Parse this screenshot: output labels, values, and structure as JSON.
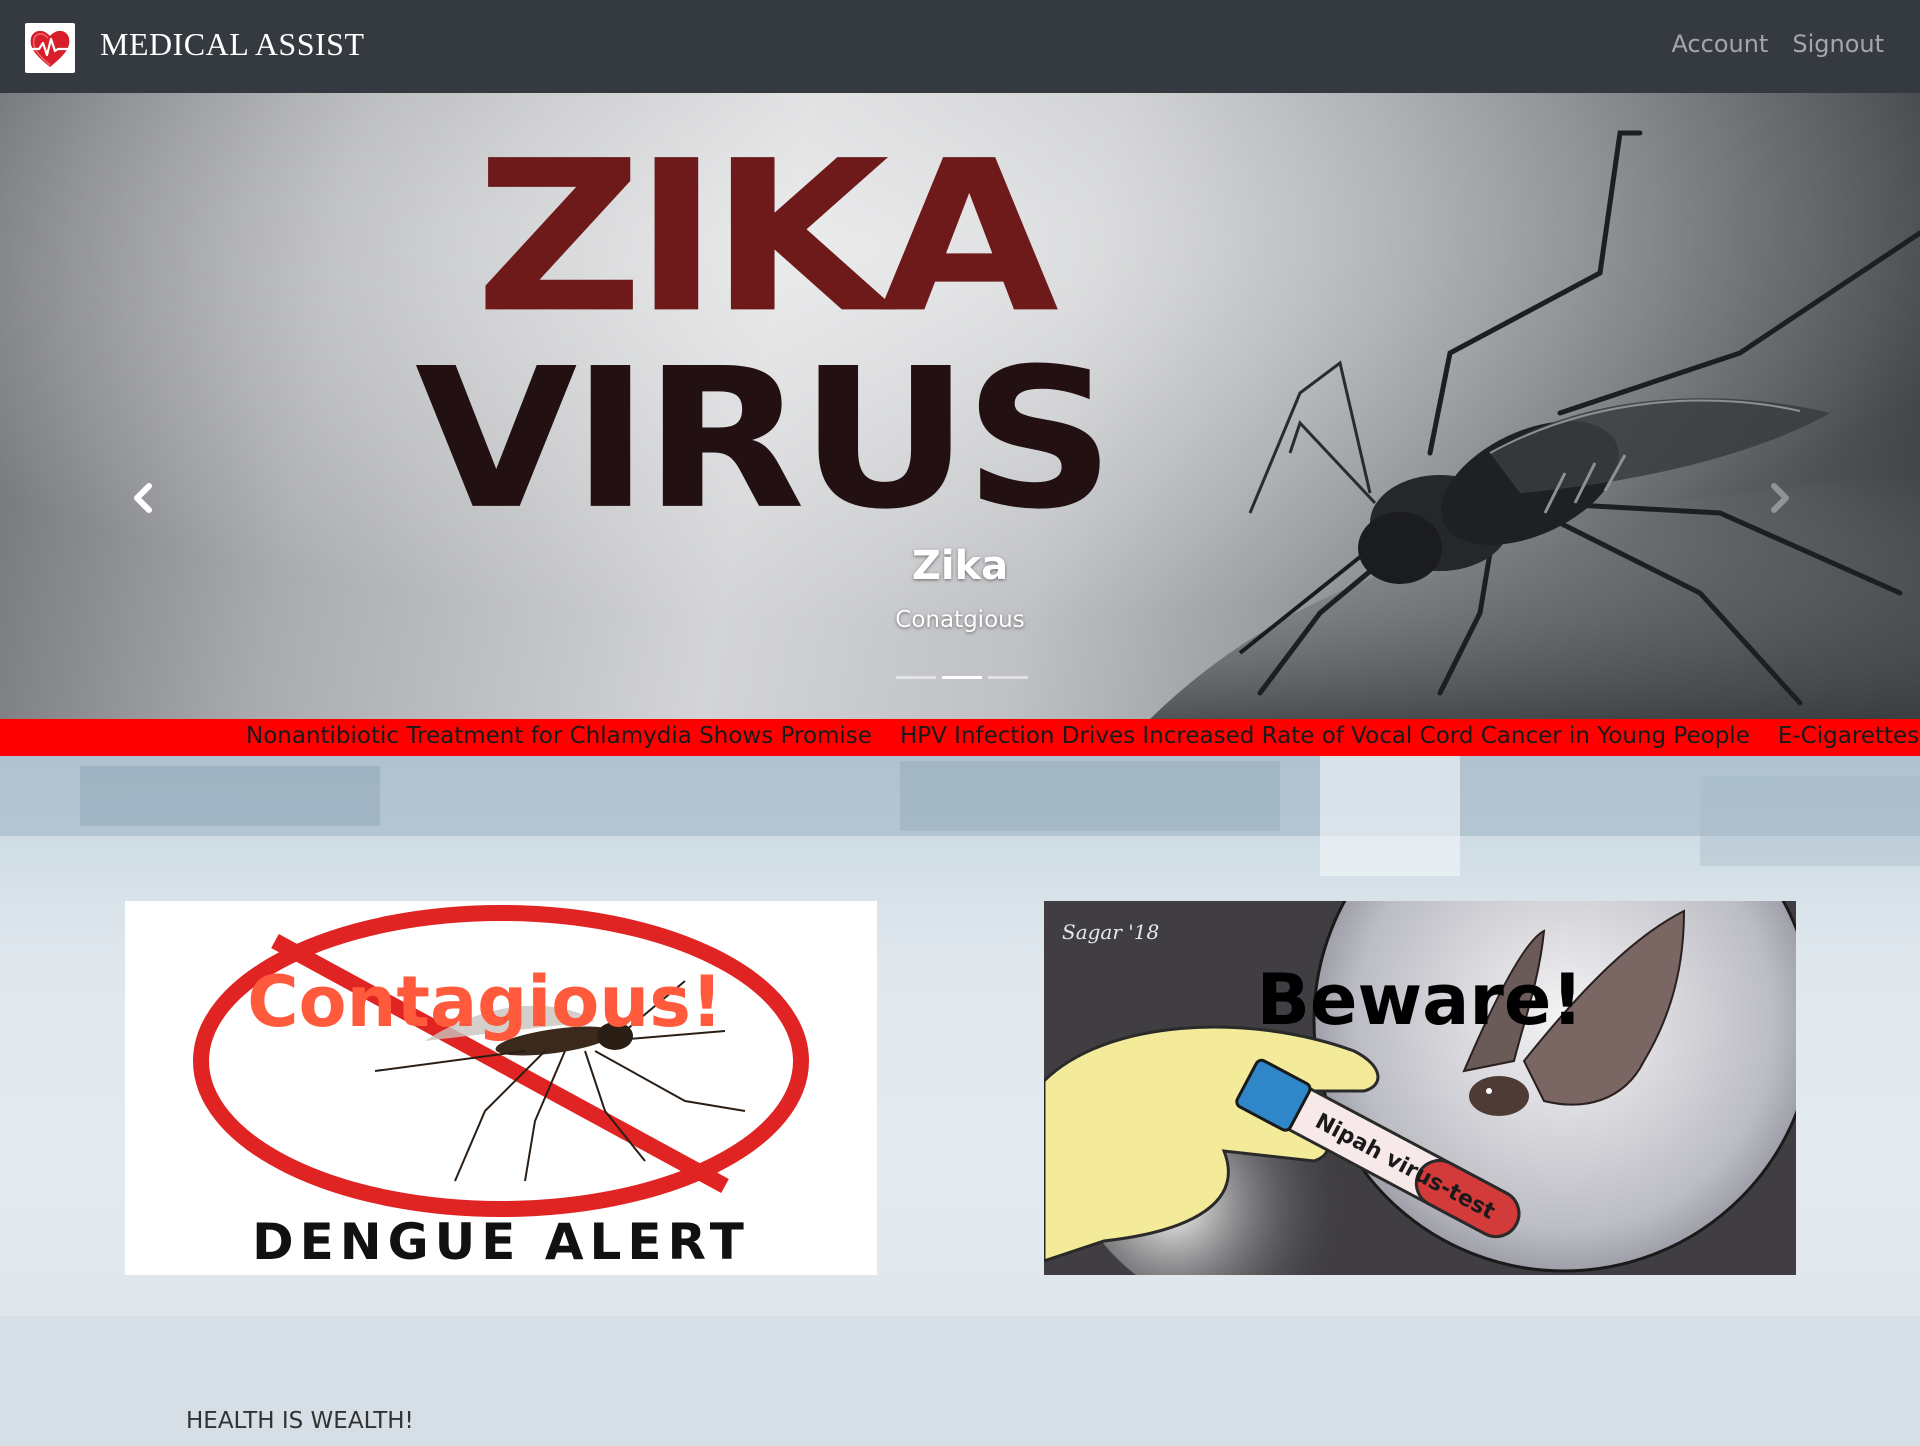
{
  "navbar": {
    "brand": "MEDICAL ASSIST",
    "logo_icon": "heart-pulse-icon",
    "links": [
      {
        "label": "Account"
      },
      {
        "label": "Signout"
      }
    ]
  },
  "carousel": {
    "slide_heading_line1": "ZIKA",
    "slide_heading_line2": "VIRUS",
    "caption_title": "Zika",
    "caption_subtitle": "Conatgious",
    "active_slide": 2,
    "slide_count": 3,
    "prev_icon": "chevron-left-icon",
    "next_icon": "chevron-right-icon"
  },
  "ticker": {
    "items": [
      "Nonantibiotic Treatment for Chlamydia Shows Promise",
      "HPV Infection Drives Increased Rate of Vocal Cord Cancer in Young People",
      "E-Cigarettes Help"
    ],
    "color": "#ff0000"
  },
  "cards": {
    "left": {
      "overlay": "Contagious!",
      "label": "DENGUE ALERT"
    },
    "right": {
      "overlay": "Beware!",
      "signature": "Sagar '18",
      "tube_label": "Nipah virus-test"
    }
  },
  "footer": {
    "text": "HEALTH IS WEALTH!"
  }
}
